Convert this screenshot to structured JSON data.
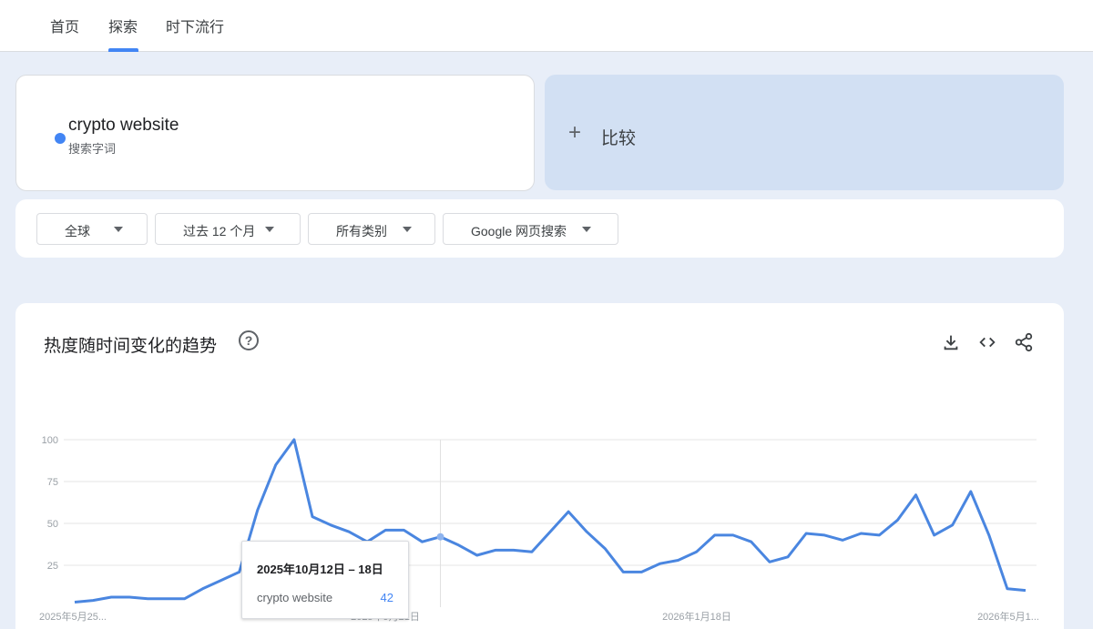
{
  "nav": {
    "tabs": [
      {
        "label": "首页"
      },
      {
        "label": "探索"
      },
      {
        "label": "时下流行"
      }
    ]
  },
  "search_term": {
    "name": "crypto website",
    "type": "搜索字词",
    "color": "#4285f4"
  },
  "compare": {
    "plus": "+",
    "label": "比较"
  },
  "filters": [
    {
      "label": "全球"
    },
    {
      "label": "过去 12 个月"
    },
    {
      "label": "所有类别"
    },
    {
      "label": "Google 网页搜索"
    }
  ],
  "chart_section": {
    "title": "热度随时间变化的趋势",
    "help": "?",
    "icons": [
      "download-icon",
      "embed-icon",
      "share-icon"
    ]
  },
  "chart_data": {
    "type": "line",
    "ylim": [
      0,
      100
    ],
    "yticks": [
      25,
      50,
      75,
      100
    ],
    "x_labels": [
      "2025年5月25...",
      "2025年9月21日",
      "2026年1月18日",
      "2026年5月1..."
    ],
    "series": [
      {
        "name": "crypto website",
        "color": "#4a86e0",
        "values": [
          3,
          4,
          6,
          6,
          5,
          5,
          5,
          11,
          16,
          21,
          58,
          85,
          100,
          54,
          49,
          45,
          39,
          46,
          46,
          39,
          42,
          37,
          31,
          34,
          34,
          33,
          45,
          57,
          45,
          35,
          21,
          21,
          26,
          28,
          33,
          43,
          43,
          39,
          27,
          30,
          44,
          43,
          40,
          44,
          43,
          52,
          67,
          43,
          49,
          69,
          43,
          11,
          10
        ]
      }
    ],
    "highlight_index": 20
  },
  "tooltip": {
    "date": "2025年10月12日 – 18日",
    "term": "crypto website",
    "value": "42"
  }
}
